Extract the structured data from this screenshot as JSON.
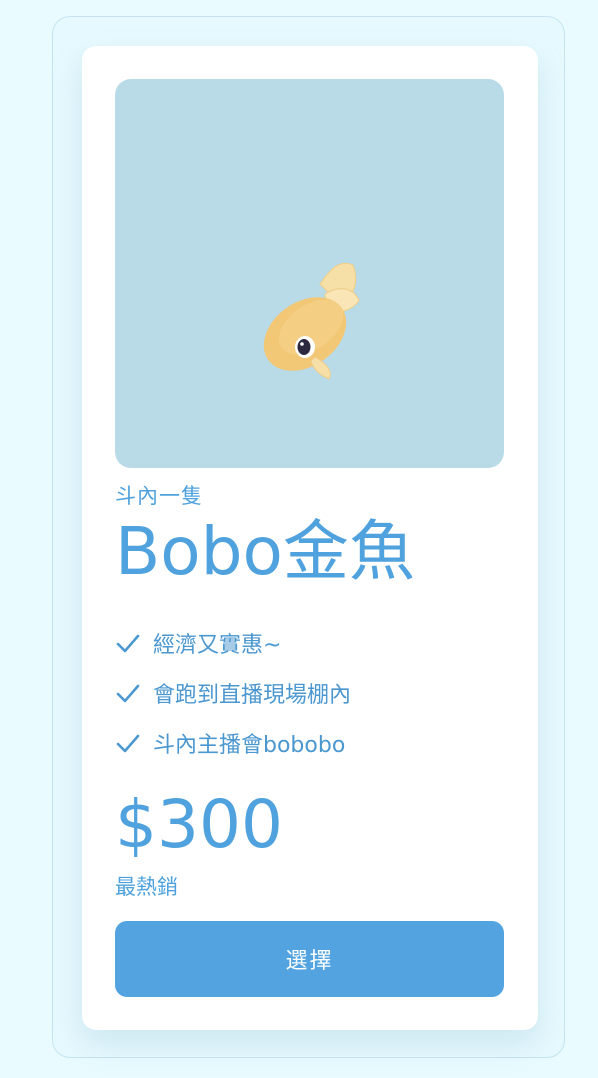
{
  "card": {
    "image_alt": "goldfish illustration",
    "subtitle": "斗內一隻",
    "title": "Bobo金魚",
    "features": [
      "經濟又實惠~",
      "會跑到直播現場棚內",
      "斗內主播會bobobo"
    ],
    "price": "$300",
    "price_note": "最熱銷",
    "select_label": "選擇"
  },
  "colors": {
    "accent": "#4fa2dd",
    "button": "#52a3df",
    "image_bg": "#b9dbe8",
    "page_bg": "#e9fbff"
  }
}
